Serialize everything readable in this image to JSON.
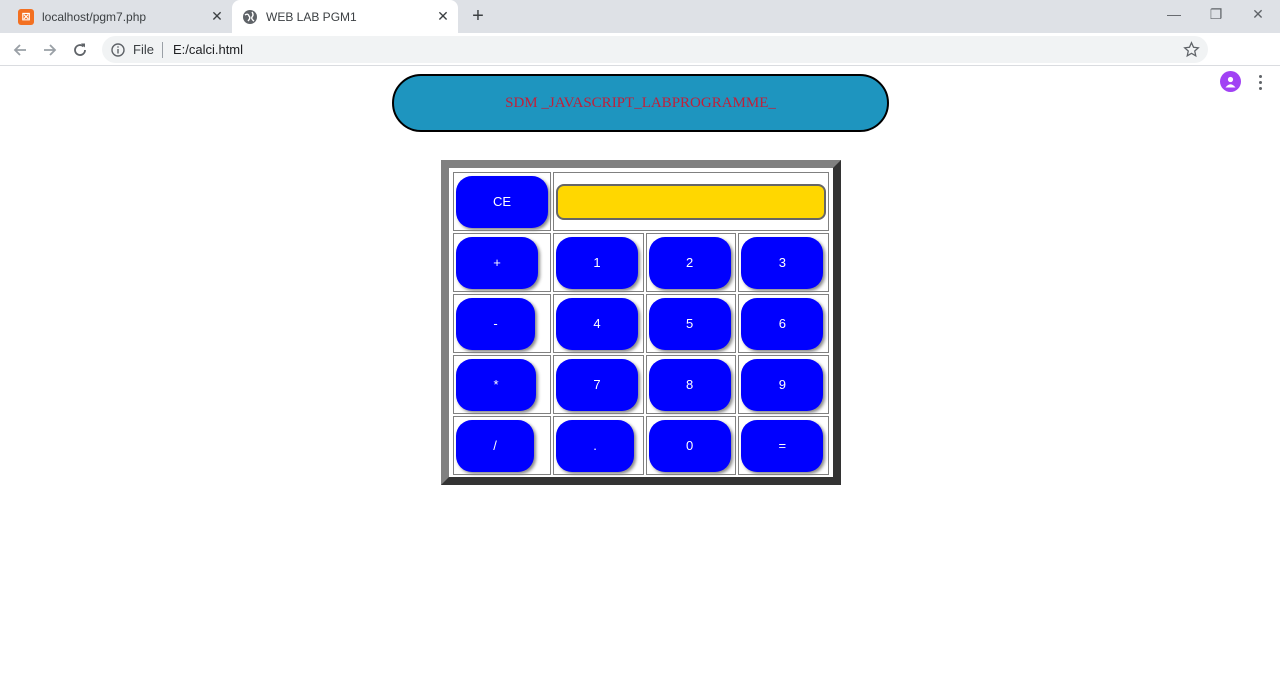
{
  "browser": {
    "tabs": [
      {
        "title": "localhost/pgm7.php",
        "favicon": "xampp-icon",
        "active": false
      },
      {
        "title": "WEB LAB PGM1",
        "favicon": "globe-icon",
        "active": true
      }
    ],
    "new_tab_label": "+",
    "omnibox": {
      "scheme_label": "File",
      "url": "E:/calci.html"
    }
  },
  "page": {
    "banner_text": "SDM _JAVASCRIPT_LABPROGRAMME_",
    "calculator": {
      "display_value": "",
      "display_color": "#ffd700",
      "button_color": "#0000ff",
      "banner_color": "#1e95bf",
      "clear_label": "CE",
      "rows": [
        {
          "op": "+",
          "keys": [
            "1",
            "2",
            "3"
          ]
        },
        {
          "op": "-",
          "keys": [
            "4",
            "5",
            "6"
          ]
        },
        {
          "op": "*",
          "keys": [
            "7",
            "8",
            "9"
          ]
        },
        {
          "op": "/",
          "keys": [
            ".",
            "0",
            "="
          ]
        }
      ]
    }
  }
}
